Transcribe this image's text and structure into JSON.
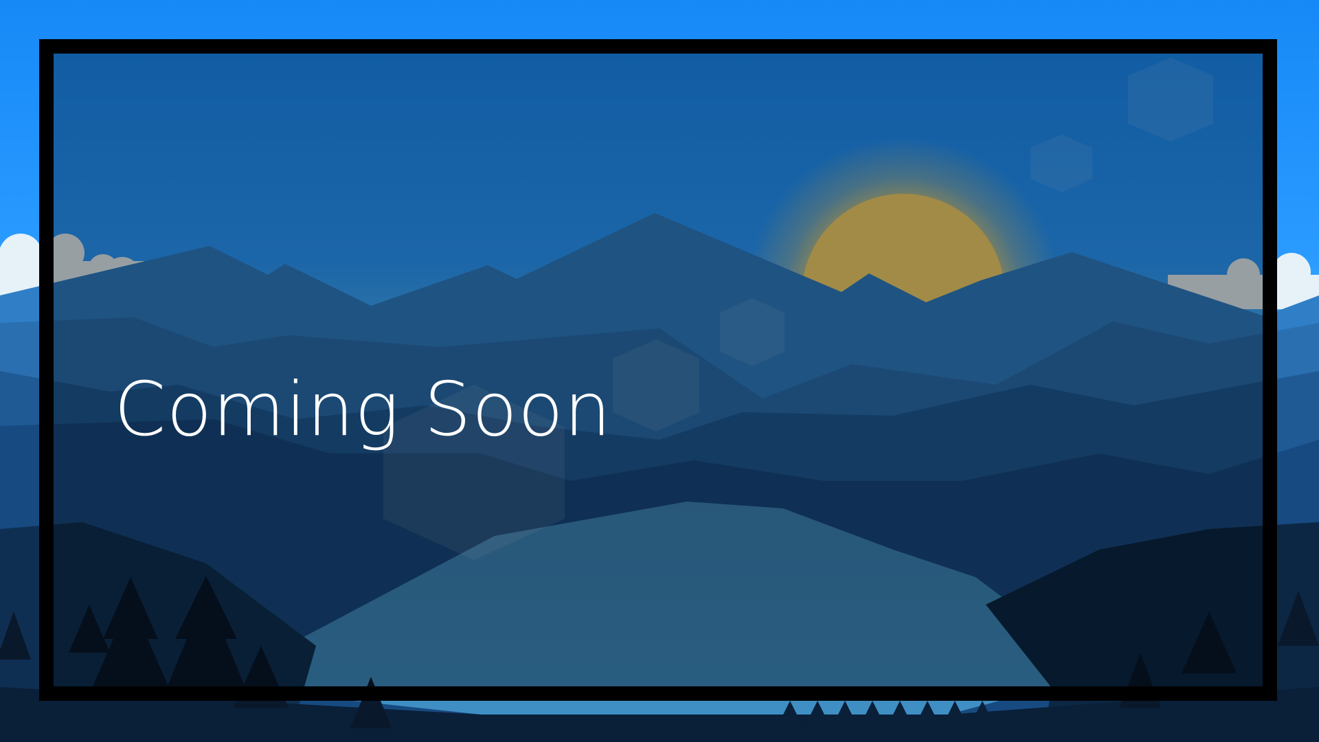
{
  "screen": {
    "headline": "Coming Soon"
  },
  "colors": {
    "sky_top": "#1a8cff",
    "sky_bottom": "#6fd0ff",
    "sun": "#f6d36b",
    "frame": "#000000",
    "headline_text": "#ffffff"
  }
}
